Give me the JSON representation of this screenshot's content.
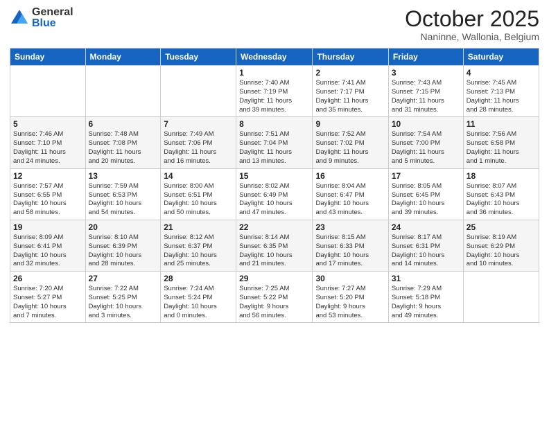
{
  "header": {
    "logo_general": "General",
    "logo_blue": "Blue",
    "month": "October 2025",
    "location": "Naninne, Wallonia, Belgium"
  },
  "weekdays": [
    "Sunday",
    "Monday",
    "Tuesday",
    "Wednesday",
    "Thursday",
    "Friday",
    "Saturday"
  ],
  "weeks": [
    [
      {
        "day": "",
        "info": ""
      },
      {
        "day": "",
        "info": ""
      },
      {
        "day": "",
        "info": ""
      },
      {
        "day": "1",
        "info": "Sunrise: 7:40 AM\nSunset: 7:19 PM\nDaylight: 11 hours\nand 39 minutes."
      },
      {
        "day": "2",
        "info": "Sunrise: 7:41 AM\nSunset: 7:17 PM\nDaylight: 11 hours\nand 35 minutes."
      },
      {
        "day": "3",
        "info": "Sunrise: 7:43 AM\nSunset: 7:15 PM\nDaylight: 11 hours\nand 31 minutes."
      },
      {
        "day": "4",
        "info": "Sunrise: 7:45 AM\nSunset: 7:13 PM\nDaylight: 11 hours\nand 28 minutes."
      }
    ],
    [
      {
        "day": "5",
        "info": "Sunrise: 7:46 AM\nSunset: 7:10 PM\nDaylight: 11 hours\nand 24 minutes."
      },
      {
        "day": "6",
        "info": "Sunrise: 7:48 AM\nSunset: 7:08 PM\nDaylight: 11 hours\nand 20 minutes."
      },
      {
        "day": "7",
        "info": "Sunrise: 7:49 AM\nSunset: 7:06 PM\nDaylight: 11 hours\nand 16 minutes."
      },
      {
        "day": "8",
        "info": "Sunrise: 7:51 AM\nSunset: 7:04 PM\nDaylight: 11 hours\nand 13 minutes."
      },
      {
        "day": "9",
        "info": "Sunrise: 7:52 AM\nSunset: 7:02 PM\nDaylight: 11 hours\nand 9 minutes."
      },
      {
        "day": "10",
        "info": "Sunrise: 7:54 AM\nSunset: 7:00 PM\nDaylight: 11 hours\nand 5 minutes."
      },
      {
        "day": "11",
        "info": "Sunrise: 7:56 AM\nSunset: 6:58 PM\nDaylight: 11 hours\nand 1 minute."
      }
    ],
    [
      {
        "day": "12",
        "info": "Sunrise: 7:57 AM\nSunset: 6:55 PM\nDaylight: 10 hours\nand 58 minutes."
      },
      {
        "day": "13",
        "info": "Sunrise: 7:59 AM\nSunset: 6:53 PM\nDaylight: 10 hours\nand 54 minutes."
      },
      {
        "day": "14",
        "info": "Sunrise: 8:00 AM\nSunset: 6:51 PM\nDaylight: 10 hours\nand 50 minutes."
      },
      {
        "day": "15",
        "info": "Sunrise: 8:02 AM\nSunset: 6:49 PM\nDaylight: 10 hours\nand 47 minutes."
      },
      {
        "day": "16",
        "info": "Sunrise: 8:04 AM\nSunset: 6:47 PM\nDaylight: 10 hours\nand 43 minutes."
      },
      {
        "day": "17",
        "info": "Sunrise: 8:05 AM\nSunset: 6:45 PM\nDaylight: 10 hours\nand 39 minutes."
      },
      {
        "day": "18",
        "info": "Sunrise: 8:07 AM\nSunset: 6:43 PM\nDaylight: 10 hours\nand 36 minutes."
      }
    ],
    [
      {
        "day": "19",
        "info": "Sunrise: 8:09 AM\nSunset: 6:41 PM\nDaylight: 10 hours\nand 32 minutes."
      },
      {
        "day": "20",
        "info": "Sunrise: 8:10 AM\nSunset: 6:39 PM\nDaylight: 10 hours\nand 28 minutes."
      },
      {
        "day": "21",
        "info": "Sunrise: 8:12 AM\nSunset: 6:37 PM\nDaylight: 10 hours\nand 25 minutes."
      },
      {
        "day": "22",
        "info": "Sunrise: 8:14 AM\nSunset: 6:35 PM\nDaylight: 10 hours\nand 21 minutes."
      },
      {
        "day": "23",
        "info": "Sunrise: 8:15 AM\nSunset: 6:33 PM\nDaylight: 10 hours\nand 17 minutes."
      },
      {
        "day": "24",
        "info": "Sunrise: 8:17 AM\nSunset: 6:31 PM\nDaylight: 10 hours\nand 14 minutes."
      },
      {
        "day": "25",
        "info": "Sunrise: 8:19 AM\nSunset: 6:29 PM\nDaylight: 10 hours\nand 10 minutes."
      }
    ],
    [
      {
        "day": "26",
        "info": "Sunrise: 7:20 AM\nSunset: 5:27 PM\nDaylight: 10 hours\nand 7 minutes."
      },
      {
        "day": "27",
        "info": "Sunrise: 7:22 AM\nSunset: 5:25 PM\nDaylight: 10 hours\nand 3 minutes."
      },
      {
        "day": "28",
        "info": "Sunrise: 7:24 AM\nSunset: 5:24 PM\nDaylight: 10 hours\nand 0 minutes."
      },
      {
        "day": "29",
        "info": "Sunrise: 7:25 AM\nSunset: 5:22 PM\nDaylight: 9 hours\nand 56 minutes."
      },
      {
        "day": "30",
        "info": "Sunrise: 7:27 AM\nSunset: 5:20 PM\nDaylight: 9 hours\nand 53 minutes."
      },
      {
        "day": "31",
        "info": "Sunrise: 7:29 AM\nSunset: 5:18 PM\nDaylight: 9 hours\nand 49 minutes."
      },
      {
        "day": "",
        "info": ""
      }
    ]
  ]
}
